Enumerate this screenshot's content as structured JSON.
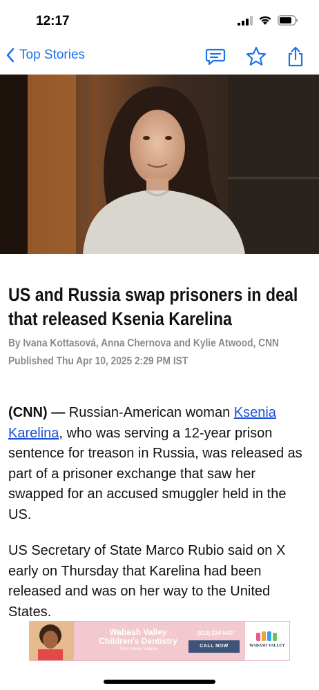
{
  "status_bar": {
    "time": "12:17"
  },
  "nav": {
    "back_label": "Top Stories",
    "icons": [
      "chevron-left-icon",
      "comment-icon",
      "star-icon",
      "share-icon"
    ],
    "accent_color": "#1a73e8"
  },
  "hero": {
    "image": "photo of a woman with dark hair in a grey sweater"
  },
  "article": {
    "headline": "US and Russia swap prisoners in deal that released Ksenia Karelina",
    "byline": "By Ivana Kottasová, Anna Chernova and Kylie Atwood, CNN",
    "published": "Published Thu Apr 10, 2025 2:29 PM IST",
    "p1_dateline": "(CNN) —",
    "p1_part1": " Russian-American woman ",
    "p1_link": "Ksenia Karelina",
    "p1_part2": ", who was serving a 12-year prison sentence for treason in Russia, was released as part of a prisoner exchange that saw her swapped for an accused smuggler held in the US.",
    "p2": "US Secretary of State Marco Rubio said on X early on Thursday that Karelina had been released and was on her way to the United States."
  },
  "ad": {
    "name_line1": "Wabash Valley",
    "name_line2": "Children's Dentistry",
    "city": "Terre Haute, Indiana",
    "phone": "(812) 234-5437",
    "cta": "CALL NOW",
    "logo_text": "WABASH VALLEY",
    "background_color": "#f2c9cf",
    "cta_color": "#3d5478"
  }
}
